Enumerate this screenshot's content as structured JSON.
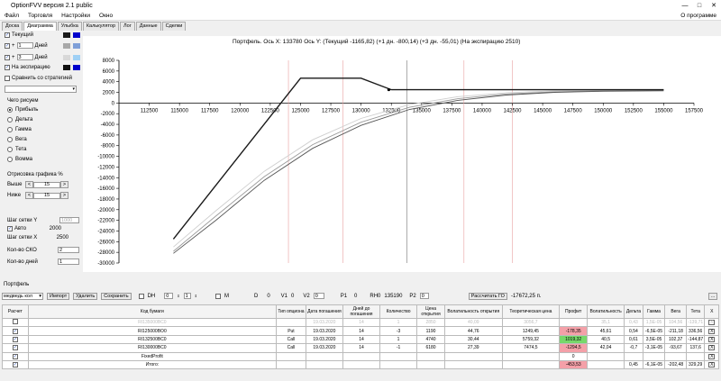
{
  "window": {
    "title": "OptionFVV версия 2.1 public",
    "min": "—",
    "max": "□",
    "close": "✕"
  },
  "menu": {
    "items": [
      "Файл",
      "Торговля",
      "Настройки",
      "Окно"
    ],
    "about": "О программе"
  },
  "tabs": [
    "Доска",
    "Диаграмма",
    "Улыбка",
    "Калькулятор",
    "Лог",
    "Данные",
    "Сделки"
  ],
  "left": {
    "curves": [
      {
        "label": "Текущий",
        "checked": true,
        "color1": "#1a1a1a",
        "color2": "#0000cc"
      },
      {
        "sign": "+",
        "val": "1",
        "unit": "Дней",
        "checked": true,
        "color1": "#a8a8a8",
        "color2": "#7f9fd8"
      },
      {
        "sign": "+",
        "val": "3",
        "unit": "Дней",
        "checked": true,
        "color1": "#d8d8d8",
        "color2": "#9fd0f5"
      },
      {
        "label": "На экспирацию",
        "checked": true,
        "color1": "#111111",
        "color2": "#0000cc"
      }
    ],
    "compare": "Сравнить со стратегией",
    "draw_title": "Чего рисуем",
    "radios": [
      "Прибыль",
      "Дельта",
      "Гамма",
      "Вега",
      "Тета",
      "Вомма"
    ],
    "offset_title": "Отрисовка графика %",
    "above": "Выше",
    "above_val": "15",
    "below": "Ниже",
    "below_val": "15",
    "gridY": "Шаг сетки Y",
    "gridY_val": "1000",
    "auto": "Авто",
    "auto_val": "2000",
    "gridX": "Шаг сетки X",
    "gridX_val": "2500",
    "sko": "Кол-во СКО",
    "sko_val": "2",
    "days": "Кол-во дней",
    "days_val": "1"
  },
  "chart_title": "Портфель. Ось X: 133780 Ось Y: (Текущий -1165,82) (+1 дн. -800,14) (+3 дн. -55,01) (На экспирацию 2510)",
  "chart_data": {
    "type": "line",
    "xlim": [
      110000,
      157500
    ],
    "ylim": [
      -30000,
      8000
    ],
    "xticks": [
      112500,
      115000,
      117500,
      120000,
      122500,
      125000,
      127500,
      130000,
      132500,
      135000,
      137500,
      140000,
      142500,
      145000,
      147500,
      150000,
      152500,
      155000,
      157500
    ],
    "yticks": [
      8000,
      6000,
      4000,
      2000,
      0,
      -2000,
      -4000,
      -6000,
      -8000,
      -10000,
      -12000,
      -14000,
      -16000,
      -18000,
      -20000,
      -22000,
      -24000,
      -26000,
      -28000,
      -30000
    ],
    "cursor_x": 133780,
    "ref_lines": [
      124000,
      128500,
      138500,
      142500
    ],
    "series": [
      {
        "color": "#1a1a1a",
        "x": [
          114500,
          125000,
          130000,
          132500,
          135000,
          140000,
          145000,
          150000,
          155000
        ],
        "y": [
          -25500,
          4650,
          4650,
          2500,
          2500,
          2500,
          2500,
          2500,
          2500
        ]
      },
      {
        "color": "#555555",
        "x": [
          114500,
          118000,
          122000,
          126000,
          130000,
          134000,
          138000,
          142000,
          146000,
          150000,
          155000
        ],
        "y": [
          -28200,
          -22000,
          -14500,
          -8500,
          -4200,
          -1200,
          500,
          1500,
          2000,
          2200,
          2300
        ]
      },
      {
        "color": "#9a9a9a",
        "x": [
          114500,
          118000,
          122000,
          126000,
          130000,
          134000,
          138000,
          142000,
          146000,
          150000,
          155000
        ],
        "y": [
          -27800,
          -21200,
          -13800,
          -7800,
          -3600,
          -800,
          800,
          1700,
          2100,
          2300,
          2400
        ]
      },
      {
        "color": "#cfcfcf",
        "x": [
          114500,
          118000,
          122000,
          126000,
          130000,
          134000,
          138000,
          142000,
          146000,
          150000,
          155000
        ],
        "y": [
          -27000,
          -20200,
          -12800,
          -6900,
          -2900,
          -300,
          1200,
          1900,
          2300,
          2450,
          2500
        ]
      }
    ]
  },
  "portfolio": {
    "label": "Портфель",
    "name": "медведь кол",
    "import": "Импорт",
    "delete": "Удалить",
    "save": "Сохранить",
    "dh": "DH",
    "dh_v1": "0",
    "dh_v2": "1",
    "m": "M",
    "d": "D",
    "d_val": "0",
    "v1": "V1",
    "v1_val": "0",
    "v2": "V2",
    "v2_val": "0",
    "p1": "P1",
    "p1_val": "0",
    "rh": "RH0",
    "rh_val": "135190",
    "p2": "P2",
    "p2_val": "0",
    "calc": "Рассчитать ГО",
    "calc_val": "-17672,25 п.",
    "more": "..."
  },
  "table": {
    "headers": [
      "Расчет",
      "Код бумаги",
      "Тип опциона",
      "Дата погашения",
      "Дней до погашения",
      "Количество",
      "Цена открытия",
      "Волатильность открытия",
      "Теоретическая цена",
      "Профит",
      "Волатильность",
      "Дельта",
      "Гамма",
      "Вега",
      "Тета",
      "X"
    ],
    "rows": [
      {
        "grey": true,
        "chk": "",
        "cells": [
          "",
          "RI135000BC0",
          "",
          "19.03.2020",
          "14",
          "1",
          "2850",
          "40,09",
          "3056,7",
          "",
          "35,1",
          "0,43",
          "1,5E-05",
          "104,56",
          "-139,71",
          "X"
        ]
      },
      {
        "chk": "✓",
        "cells": [
          "",
          "RI125000BO0",
          "Put",
          "19.03.2020",
          "14",
          "-3",
          "1190",
          "44,76",
          "1249,45",
          "-178,35",
          "45,61",
          "0,54",
          "-6,5E-05",
          "-211,18",
          "336,56",
          "X"
        ]
      },
      {
        "chk": "✓",
        "cells": [
          "",
          "RI132500BC0",
          "Call",
          "19.03.2020",
          "14",
          "1",
          "4740",
          "30,44",
          "5759,32",
          "1019,32",
          "40,5",
          "0,61",
          "3,5E-05",
          "102,37",
          "-144,87",
          "X"
        ]
      },
      {
        "chk": "✓",
        "cells": [
          "",
          "RI130000BC0",
          "Call",
          "19.03.2020",
          "14",
          "-1",
          "6180",
          "27,39",
          "7474,5",
          "-1294,5",
          "42,04",
          "-0,7",
          "-3,1E-05",
          "-93,67",
          "137,6",
          "X"
        ]
      },
      {
        "chk": "✓",
        "cells": [
          "",
          "FixedProfit",
          "",
          "",
          "",
          "",
          "",
          "",
          "",
          "0",
          "",
          "",
          "",
          "",
          "",
          "X"
        ]
      },
      {
        "chk": "✓",
        "cells": [
          "",
          "Итого:",
          "",
          "",
          "",
          "",
          "",
          "",
          "",
          "-453,53",
          "",
          "0,45",
          "-6,1E-05",
          "-202,48",
          "329,29",
          "X"
        ]
      }
    ]
  }
}
